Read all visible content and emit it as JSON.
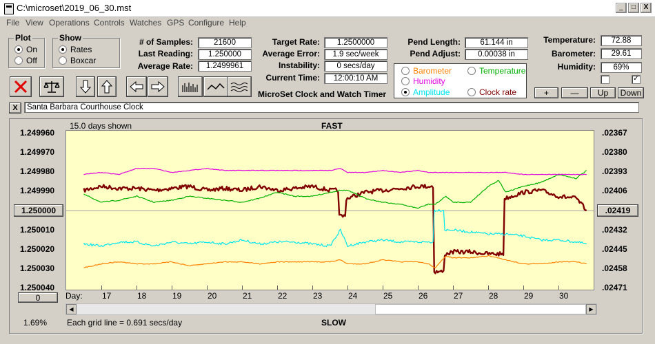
{
  "window": {
    "title": "C:\\microset\\2019_06_30.mst",
    "min": "_",
    "max": "□",
    "close": "X"
  },
  "menu": [
    "File",
    "View",
    "Operations",
    "Controls",
    "Watches",
    "GPS",
    "Configure",
    "Help"
  ],
  "plot_group": {
    "title": "Plot",
    "on": "On",
    "off": "Off",
    "selected": "On"
  },
  "show_group": {
    "title": "Show",
    "rates": "Rates",
    "boxcar": "Boxcar",
    "selected": "Rates"
  },
  "stats": {
    "samples_label": "# of Samples:",
    "samples": "21600",
    "last_label": "Last Reading:",
    "last": "1.250000",
    "avg_label": "Average Rate:",
    "avg": "1.2499961"
  },
  "rates": {
    "target_label": "Target Rate:",
    "target": "1.2500000",
    "avg_err_label": "Average Error:",
    "avg_err": "1.9 sec/week",
    "instab_label": "Instability:",
    "instab": "0 secs/day",
    "time_label": "Current Time:",
    "time": "12:00:10 AM",
    "app_name": "MicroSet Clock and Watch Timer"
  },
  "pend": {
    "length_label": "Pend Length:",
    "length": "61.144 in",
    "adjust_label": "Pend Adjust:",
    "adjust": "0.00038 in"
  },
  "legend": {
    "barometer": "Barometer",
    "temperature": "Temperature",
    "humidity": "Humidity",
    "amplitude": "Amplitude",
    "clock_rate": "Clock rate",
    "selected": "Amplitude",
    "colors": {
      "barometer": "#ff8000",
      "temperature": "#00b000",
      "humidity": "#e000e0",
      "amplitude": "#00e5ee",
      "clock_rate": "#800000"
    }
  },
  "env": {
    "temp_label": "Temperature:",
    "temp": "72.88",
    "baro_label": "Barometer:",
    "baro": "29.61",
    "hum_label": "Humidity:",
    "hum": "69%",
    "check1": false,
    "check2": true,
    "plus": "+",
    "minus": "—",
    "up": "Up",
    "down": "Down"
  },
  "toolbar_icons": [
    "stop-icon",
    "balance-icon",
    "arrow-down-icon",
    "arrow-up-icon",
    "arrow-left-icon",
    "arrow-right-icon",
    "bars-chart-icon",
    "line-chart-icon",
    "waves-icon"
  ],
  "clock_name": "Santa Barbara Courthouse Clock",
  "clear_btn": "X",
  "chart": {
    "days_shown": "15.0 days shown",
    "fast": "FAST",
    "slow": "SLOW",
    "grid_note": "Each grid line = 0.691 secs/day",
    "left_ticks": [
      "1.249960",
      "1.249970",
      "1.249980",
      "1.249990",
      "1.250000",
      "1.250010",
      "1.250020",
      "1.250030",
      "1.250040"
    ],
    "right_ticks": [
      ".02367",
      ".02380",
      ".02393",
      ".02406",
      ".02419",
      ".02432",
      ".02445",
      ".02458",
      ".02471"
    ],
    "center_left": "1.250000",
    "center_right": ".02419",
    "offset_btn": "0",
    "percent": "1.69%",
    "day_label": "Day:",
    "days": [
      "17",
      "18",
      "19",
      "20",
      "21",
      "22",
      "23",
      "24",
      "25",
      "26",
      "27",
      "28",
      "29",
      "30"
    ]
  },
  "chart_data": {
    "type": "line",
    "x": [
      16.5,
      17.0,
      17.5,
      18.0,
      18.5,
      19.0,
      19.5,
      20.0,
      20.5,
      21.0,
      21.5,
      22.0,
      22.5,
      23.0,
      23.5,
      23.8,
      24.0,
      24.5,
      25.0,
      25.5,
      26.0,
      26.3,
      26.5,
      26.8,
      27.0,
      27.5,
      28.0,
      28.3,
      28.5,
      29.0,
      29.5,
      30.0,
      30.5,
      30.8
    ],
    "ylim": [
      1.25004,
      1.24996
    ],
    "series": [
      {
        "name": "Clock rate",
        "color": "#800000",
        "values": [
          1.24999,
          1.249988,
          1.249989,
          1.249989,
          1.24999,
          1.249989,
          1.249988,
          1.24999,
          1.249989,
          1.24999,
          1.249988,
          1.24999,
          1.249989,
          1.249988,
          1.24999,
          1.250003,
          1.249994,
          1.249991,
          1.24999,
          1.249989,
          1.249988,
          1.249988,
          1.250031,
          1.250022,
          1.250021,
          1.250021,
          1.250022,
          1.250022,
          1.249994,
          1.249991,
          1.24999,
          1.249993,
          1.249994,
          1.25
        ]
      },
      {
        "name": "Amplitude",
        "color": "#00e5ee",
        "values": [
          1.250017,
          1.250018,
          1.250016,
          1.250016,
          1.250018,
          1.250016,
          1.250017,
          1.250016,
          1.250017,
          1.250015,
          1.250017,
          1.250016,
          1.250016,
          1.250017,
          1.250018,
          1.25001,
          1.250018,
          1.250016,
          1.250015,
          1.250016,
          1.250016,
          1.250016,
          1.25,
          1.25001,
          1.25001,
          1.250011,
          1.250012,
          1.250012,
          1.250012,
          1.250013,
          1.250015,
          1.250015,
          1.250016,
          1.250017
        ]
      },
      {
        "name": "Temperature",
        "color": "#00b000",
        "values": [
          1.249992,
          1.249996,
          1.249995,
          1.249993,
          1.249996,
          1.249995,
          1.249993,
          1.249994,
          1.249995,
          1.249996,
          1.249994,
          1.249991,
          1.249993,
          1.249993,
          1.249991,
          1.24999,
          1.24999,
          1.249994,
          1.249996,
          1.249997,
          1.249999,
          1.249997,
          1.249997,
          1.249993,
          1.249996,
          1.249996,
          1.249988,
          1.249985,
          1.249991,
          1.249988,
          1.249986,
          1.249982,
          1.249984,
          1.24998
        ]
      },
      {
        "name": "Humidity",
        "color": "#e000e0",
        "values": [
          1.249982,
          1.249981,
          1.249982,
          1.249979,
          1.249979,
          1.249981,
          1.24998,
          1.249979,
          1.24998,
          1.24998,
          1.24998,
          1.24998,
          1.24998,
          1.24998,
          1.24998,
          1.249979,
          1.249981,
          1.249981,
          1.24998,
          1.249981,
          1.24998,
          1.249981,
          1.249981,
          1.249981,
          1.249981,
          1.249981,
          1.249981,
          1.249981,
          1.249981,
          1.249982,
          1.249982,
          1.249982,
          1.249982,
          1.249982
        ]
      },
      {
        "name": "Barometer",
        "color": "#ff8000",
        "values": [
          1.250029,
          1.250027,
          1.250026,
          1.250027,
          1.250027,
          1.250026,
          1.250028,
          1.250027,
          1.250026,
          1.250026,
          1.250027,
          1.250026,
          1.250026,
          1.250026,
          1.250026,
          1.250025,
          1.250027,
          1.250027,
          1.250025,
          1.250026,
          1.250026,
          1.250027,
          1.250029,
          1.250023,
          1.250024,
          1.250024,
          1.250023,
          1.250024,
          1.250025,
          1.250027,
          1.250027,
          1.250026,
          1.250026,
          1.250027
        ]
      }
    ]
  }
}
